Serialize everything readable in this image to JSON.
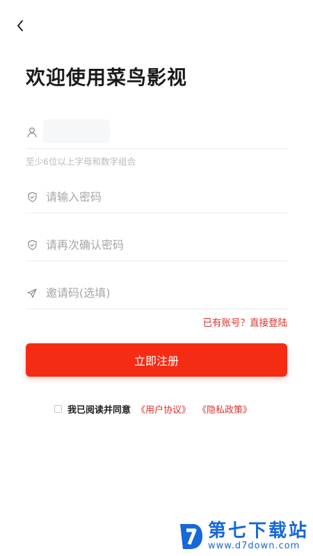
{
  "header": {
    "back_icon": "chevron-left-icon"
  },
  "title": "欢迎使用菜鸟影视",
  "form": {
    "username": {
      "icon": "user-icon",
      "value": "",
      "placeholder": ""
    },
    "username_hint": "至少6位以上字母和数字组合",
    "password": {
      "icon": "shield-icon",
      "placeholder": "请输入密码"
    },
    "confirm_password": {
      "icon": "shield-icon",
      "placeholder": "请再次确认密码"
    },
    "invite_code": {
      "icon": "send-icon",
      "placeholder": "邀请码(选填)"
    }
  },
  "login_link": "已有账号？直接登陆",
  "register_button": "立即注册",
  "agreement": {
    "checked": false,
    "text": "我已阅读并同意",
    "user_agreement": "《用户协议》",
    "privacy_policy": "《隐私政策》"
  },
  "watermark": {
    "title": "第七下载站",
    "url": "www.d7down.com"
  },
  "colors": {
    "accent": "#f52c14",
    "link": "#e0302a",
    "hint": "#b8b8b8",
    "watermark": "#1768d8"
  }
}
